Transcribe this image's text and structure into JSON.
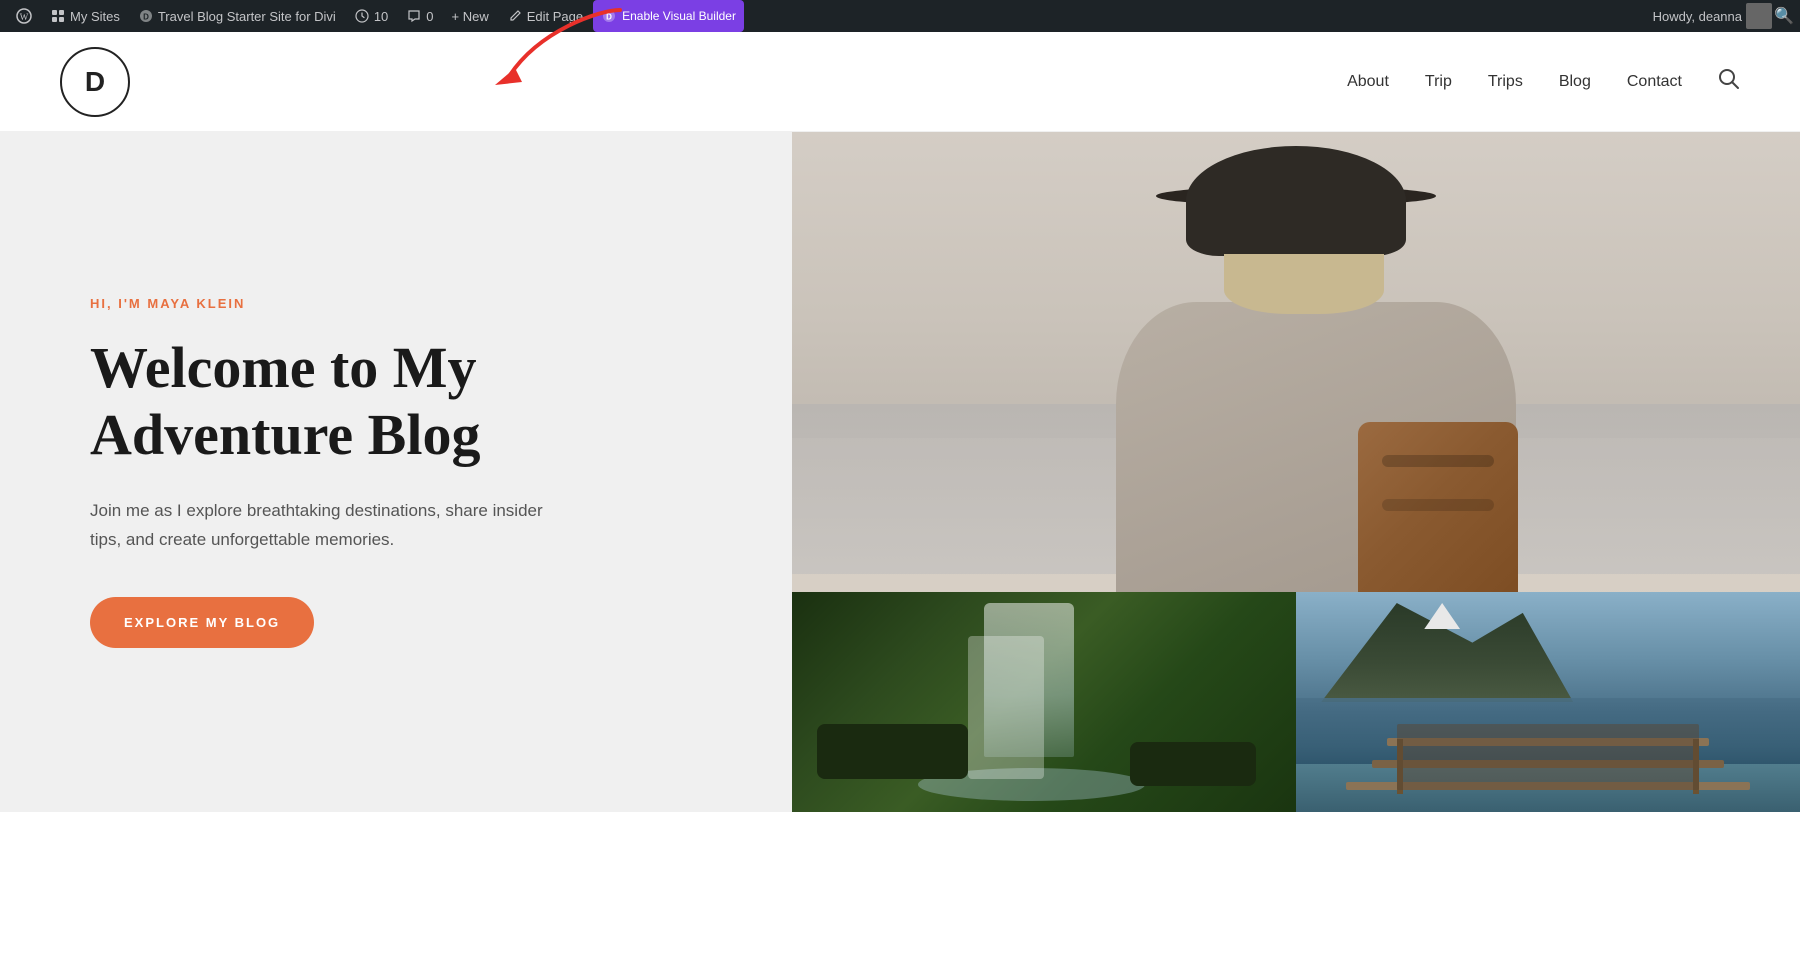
{
  "admin_bar": {
    "wp_icon": "⊞",
    "my_sites_label": "My Sites",
    "site_name": "Travel Blog Starter Site for Divi",
    "updates_count": "10",
    "comments_count": "0",
    "new_label": "+ New",
    "edit_page_label": "Edit Page",
    "enable_vb_label": "Enable Visual Builder",
    "howdy_label": "Howdy, deanna",
    "search_icon": "🔍"
  },
  "nav": {
    "about": "About",
    "trip": "Trip",
    "trips": "Trips",
    "blog": "Blog",
    "contact": "Contact"
  },
  "hero": {
    "logo_letter": "D",
    "tagline": "HI, I'M MAYA KLEIN",
    "title_line1": "Welcome to My",
    "title_line2": "Adventure Blog",
    "description": "Join me as I explore breathtaking destinations, share insider tips, and create unforgettable memories.",
    "cta_label": "EXPLORE MY BLOG"
  },
  "colors": {
    "admin_bar_bg": "#1d2327",
    "accent_orange": "#e87040",
    "hero_bg": "#f0f0f0",
    "vb_purple": "#7b3fe4"
  }
}
